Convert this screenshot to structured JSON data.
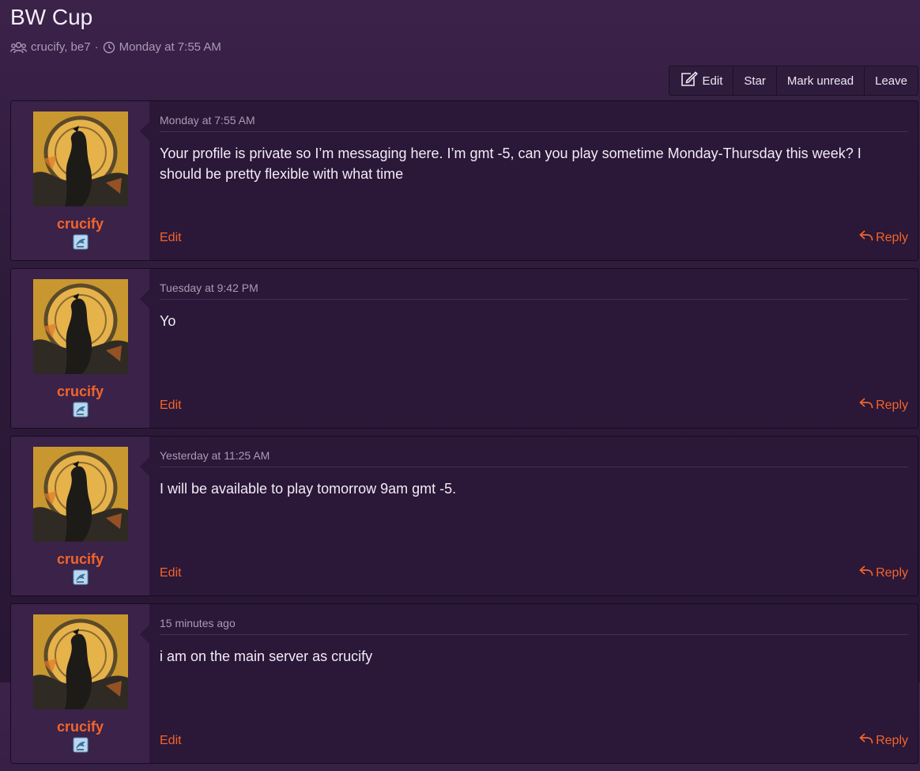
{
  "conversation": {
    "title": "BW Cup",
    "participants": "crucify, be7",
    "separator": "·",
    "started": "Monday at 7:55 AM"
  },
  "toolbar": {
    "edit_label": "Edit",
    "star_label": "Star",
    "mark_unread_label": "Mark unread",
    "leave_label": "Leave"
  },
  "messages": [
    {
      "username": "crucify",
      "time": "Monday at 7:55 AM",
      "text": "Your profile is private so I’m messaging here. I’m gmt -5, can you play sometime Monday-Thursday this week? I should be pretty flexible with what time",
      "edit_label": "Edit",
      "reply_label": "Reply"
    },
    {
      "username": "crucify",
      "time": "Tuesday at 9:42 PM",
      "text": "Yo",
      "edit_label": "Edit",
      "reply_label": "Reply"
    },
    {
      "username": "crucify",
      "time": "Yesterday at 11:25 AM",
      "text": "I will be available to play tomorrow 9am gmt -5.",
      "edit_label": "Edit",
      "reply_label": "Reply"
    },
    {
      "username": "crucify",
      "time": "15 minutes ago",
      "text": "i am on the main server as crucify",
      "edit_label": "Edit",
      "reply_label": "Reply"
    }
  ],
  "colors": {
    "accent": "#f2652a",
    "background": "#2b1738",
    "user_panel": "#3a2249"
  },
  "icons": {
    "participants": "users-icon",
    "time": "clock-icon",
    "edit": "edit-icon",
    "reply": "reply-icon",
    "badge": "rank-badge-icon"
  }
}
